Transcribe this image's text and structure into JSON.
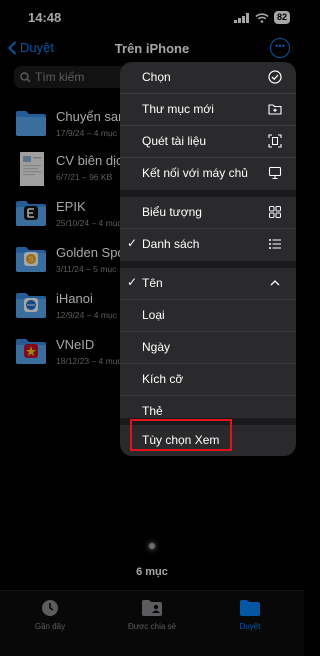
{
  "status": {
    "time": "14:48",
    "battery": "82"
  },
  "nav": {
    "back_label": "Duyệt",
    "title": "Trên iPhone"
  },
  "search": {
    "placeholder": "Tìm kiếm"
  },
  "files": [
    {
      "name": "Chuyển san",
      "meta": "17/9/24 – 4 mục"
    },
    {
      "name": "CV biên dịch",
      "meta": "6/7/21 – 96 KB"
    },
    {
      "name": "EPIK",
      "meta": "25/10/24 – 4 mục"
    },
    {
      "name": "Golden Spo",
      "meta": "3/11/24 – 5 mục"
    },
    {
      "name": "iHanoi",
      "meta": "12/9/24 – 4 mục"
    },
    {
      "name": "VNeID",
      "meta": "18/12/23 – 4 mục"
    }
  ],
  "footer": {
    "count": "6 mục"
  },
  "tabs": [
    {
      "label": "Gần đây",
      "icon": "clock-icon"
    },
    {
      "label": "Được chia sẻ",
      "icon": "shared-folder-icon"
    },
    {
      "label": "Duyệt",
      "icon": "folder-icon"
    }
  ],
  "menu": {
    "select": "Chọn",
    "new_folder": "Thư mục mới",
    "scan": "Quét tài liệu",
    "connect": "Kết nối với máy chủ",
    "icons": "Biểu tượng",
    "list": "Danh sách",
    "name": "Tên",
    "kind": "Loại",
    "date": "Ngày",
    "size": "Kích cỡ",
    "tags": "Thẻ",
    "view_options": "Tùy chọn Xem",
    "check": "✓"
  },
  "colors": {
    "accent": "#0a84ff",
    "highlight": "#e0141a"
  }
}
